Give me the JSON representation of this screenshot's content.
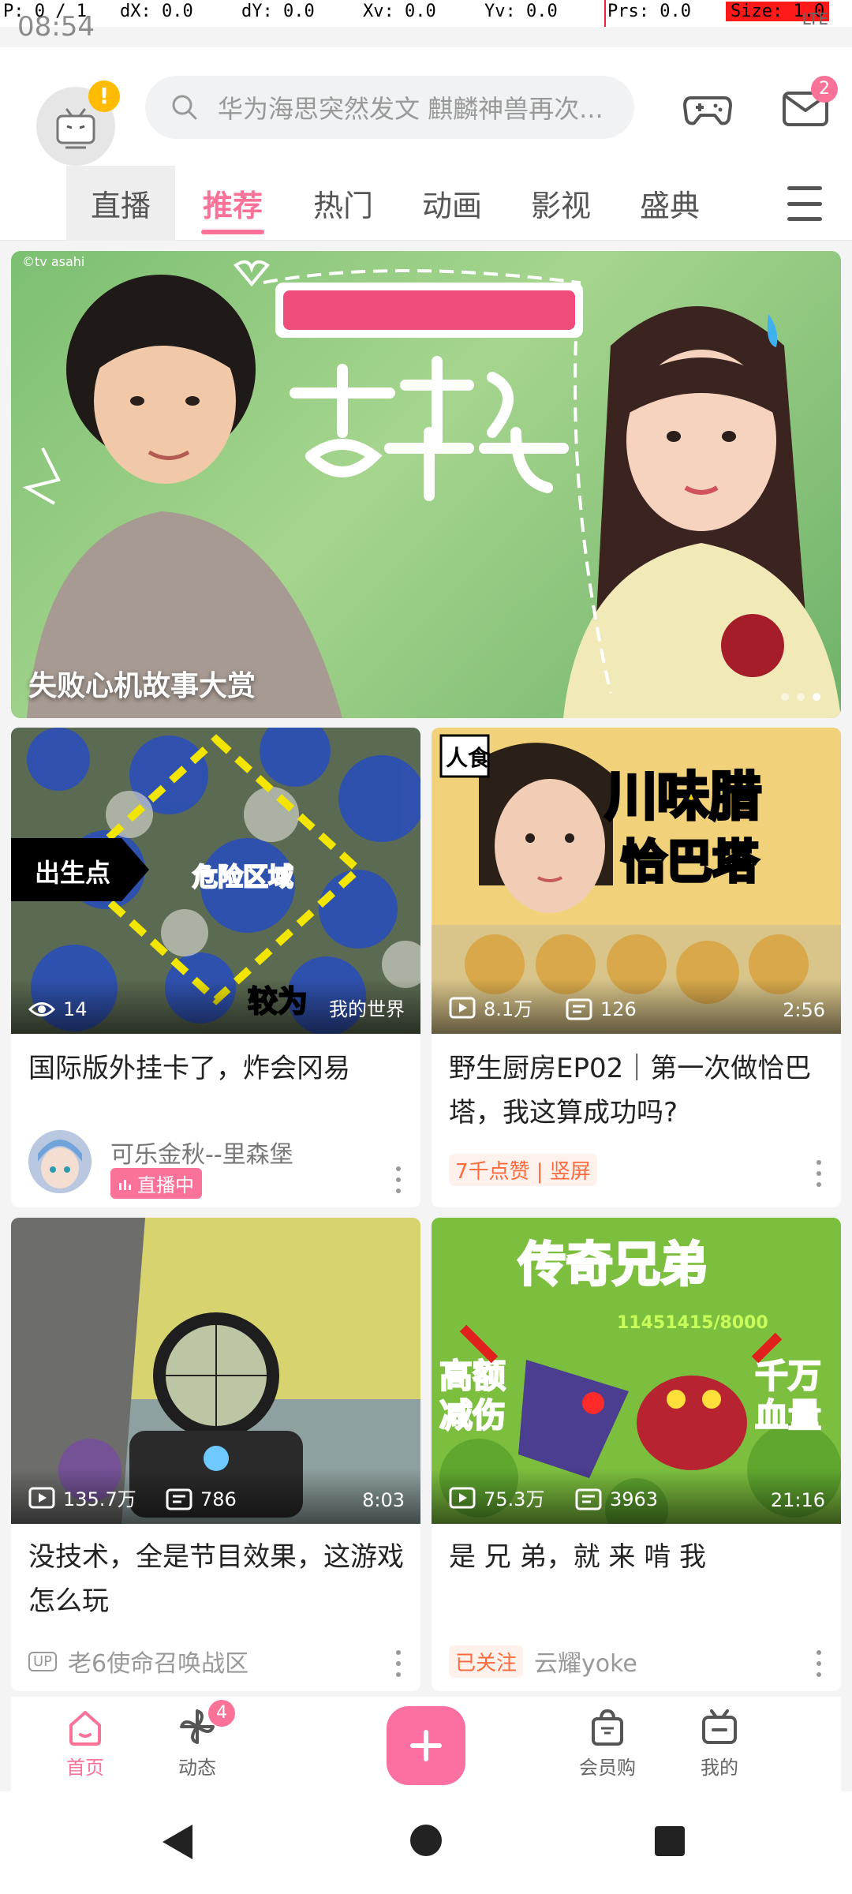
{
  "debug": {
    "pointer": "P: 0 / 1",
    "dx": "dX: 0.0",
    "dy": "dY: 0.0",
    "xv": "Xv: 0.0",
    "yv": "Yv: 0.0",
    "prs": "Prs: 0.0",
    "size": "Size: 1.0"
  },
  "status": {
    "time": "08:54",
    "network": "LTE"
  },
  "header": {
    "search_placeholder": "华为海思突然发文 麒麟神兽再次...",
    "message_badge": "2",
    "avatar_alert": "!"
  },
  "tabs": [
    {
      "label": "直播"
    },
    {
      "label": "推荐"
    },
    {
      "label": "热门"
    },
    {
      "label": "动画"
    },
    {
      "label": "影视"
    },
    {
      "label": "盛典"
    }
  ],
  "banner": {
    "caption": "失败心机故事大赏",
    "copyright": "©tv asahi"
  },
  "cards": [
    {
      "title": "国际版外挂卡了，炸会冈易",
      "views": "14",
      "channel_tag": "我的世界",
      "author": "可乐金秋--里森堡",
      "status": "直播中"
    },
    {
      "title": "野生厨房EP02｜第一次做恰巴塔，我这算成功吗?",
      "views": "8.1万",
      "comments": "126",
      "duration": "2:56",
      "tag": "7千点赞 | 竖屏"
    },
    {
      "title": "没技术，全是节目效果，这游戏怎么玩",
      "views": "135.7万",
      "comments": "786",
      "duration": "8:03",
      "up_label": "UP",
      "author": "老6使命召唤战区"
    },
    {
      "title": "是 兄 弟，就 来 啃 我",
      "views": "75.3万",
      "comments": "3963",
      "duration": "21:16",
      "tag": "已关注",
      "author": "云耀yoke"
    }
  ],
  "bottom_nav": [
    {
      "label": "首页"
    },
    {
      "label": "动态",
      "badge": "4"
    },
    {
      "label": "会员购"
    },
    {
      "label": "我的"
    }
  ],
  "colors": {
    "accent": "#fb7299",
    "bg": "#f4f4f4"
  }
}
